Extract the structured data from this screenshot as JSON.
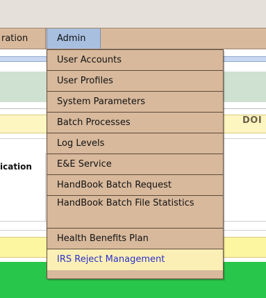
{
  "navbar": {
    "partial_item_label": "ration",
    "admin_label": "Admin"
  },
  "background": {
    "dol_text": "DOI",
    "left_label": "ication"
  },
  "menu": {
    "items": [
      {
        "label": "User Accounts"
      },
      {
        "label": "User Profiles"
      },
      {
        "label": "System Parameters"
      },
      {
        "label": "Batch Processes"
      },
      {
        "label": "Log Levels"
      },
      {
        "label": "E&E Service"
      },
      {
        "label": "HandBook Batch Request"
      },
      {
        "label": "HandBook Batch File Statistics"
      },
      {
        "label": "Health Benefits Plan"
      },
      {
        "label": "IRS Reject Management"
      }
    ]
  },
  "colors": {
    "menu_bg": "#d8b99c",
    "menu_hover_bg": "#fcefb5",
    "menu_hover_text": "#2a32c8",
    "nav_selected_bg": "#a8bfe0",
    "green_bar": "#28c64a",
    "yellow_bar": "#fdf6a0"
  }
}
